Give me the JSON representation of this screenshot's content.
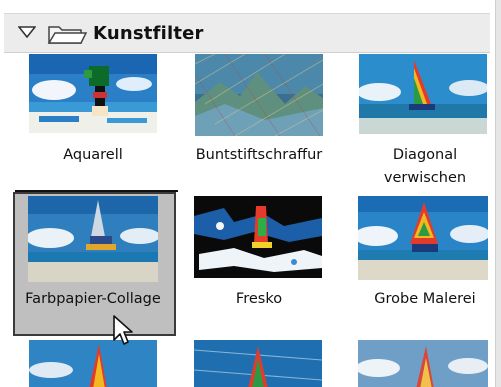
{
  "section": {
    "title": "Kunstfilter",
    "collapse_icon": "triangle-down-icon",
    "folder_icon": "folder-icon"
  },
  "filters": [
    {
      "id": "aquarell",
      "label": "Aquarell"
    },
    {
      "id": "buntstiftschraffur",
      "label": "Buntstiftschraffur"
    },
    {
      "id": "diagonal-verwischen",
      "label_line1": "Diagonal",
      "label_line2": "verwischen"
    },
    {
      "id": "farbpapier-collage",
      "label": "Farbpapier-Collage",
      "selected": true
    },
    {
      "id": "fresko",
      "label": "Fresko"
    },
    {
      "id": "grobe-malerei",
      "label": "Grobe Malerei"
    }
  ],
  "colors": {
    "header_bg": "#ececec",
    "selection_bg": "#bfbfbf",
    "sky": "#2f8fd0",
    "sea": "#1e7fb8",
    "sand": "#e9e3d0"
  }
}
